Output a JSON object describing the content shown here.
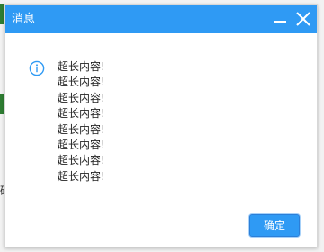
{
  "dialog": {
    "title": "消息",
    "message_lines": [
      "超长内容!",
      "超长内容!",
      "超长内容!",
      "超长内容!",
      "超长内容!",
      "超长内容!",
      "超长内容!",
      "超长内容!"
    ],
    "ok_label": "确定",
    "icons": {
      "info": "info-circle-icon",
      "minimize": "minimize-icon",
      "close": "close-icon"
    }
  },
  "background": {
    "partial_text": "码"
  },
  "colors": {
    "titlebar": "#2f9af4",
    "button": "#2f9af4",
    "background_accent": "#2e7d32"
  }
}
